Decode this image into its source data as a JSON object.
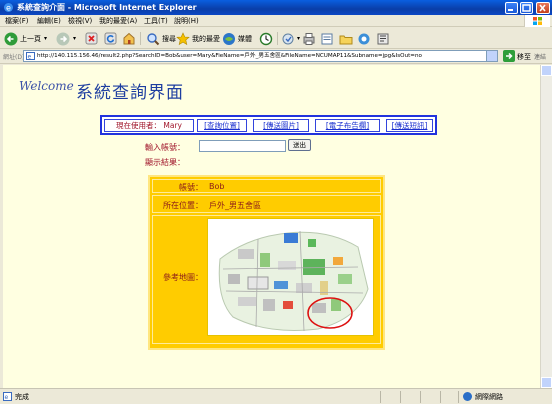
{
  "window": {
    "title": "系統查詢介面 - Microsoft Internet Explorer"
  },
  "menu": [
    "檔案(F)",
    "編輯(E)",
    "檢視(V)",
    "我的最愛(A)",
    "工具(T)",
    "說明(H)"
  ],
  "toolbar": {
    "back_label": "上一頁",
    "search_label": "搜尋",
    "favorites_label": "我的最愛",
    "media_label": "媒體"
  },
  "address": {
    "label": "網址(D)",
    "url": "http://140.115.156.46/result2.php?SearchID=Bob&user=Mary&FieName=戶外_男五舍區&FileName=NCUMAP11&Subname=jpg&IsOut=no",
    "go_label": "移至",
    "links_label": "連結"
  },
  "page": {
    "welcome": "Welcome",
    "title": "系統查詢界面",
    "nav": {
      "user_label": "現在使用者：",
      "user_value": "Mary",
      "links": [
        "[查詢位置]",
        "[傳送圖片]",
        "[電子布告欄]",
        "[傳送短訊]"
      ]
    },
    "account_label": "輸入帳號：",
    "send_button": "送出",
    "result_label": "顯示結果：",
    "result": {
      "account_label": "帳號：",
      "account_value": "Bob",
      "location_label": "所在位置：",
      "location_value": "戶外_男五舍區",
      "map_label": "參考地圖："
    }
  },
  "status": {
    "text": "完成",
    "zone": "網際網路"
  },
  "colors": {
    "titlebar": "#0a3ea8",
    "page_bg": "#ffffe1",
    "result_bg": "#ffcc00",
    "accent_red": "#a0152a",
    "link_blue": "#1a2fcf"
  }
}
